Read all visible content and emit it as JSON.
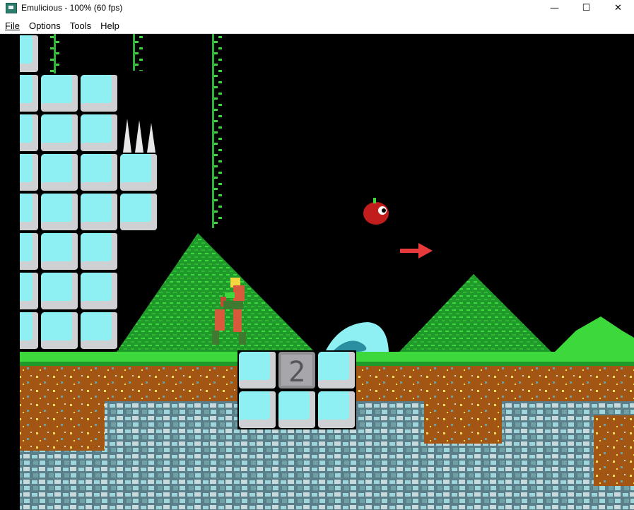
{
  "window": {
    "title": "Emulicious - 100% (60 fps)",
    "minimize_glyph": "—",
    "maximize_glyph": "☐",
    "close_glyph": "✕"
  },
  "menu": {
    "items": [
      "File",
      "Options",
      "Tools",
      "Help"
    ]
  },
  "game": {
    "block_number": "2"
  },
  "colors": {
    "ice": "#8ef0f3",
    "ice_shade": "#cfd0d4",
    "grass": "#3dd83b",
    "dirt": "#a35514",
    "rock": "#6fa0a6"
  }
}
